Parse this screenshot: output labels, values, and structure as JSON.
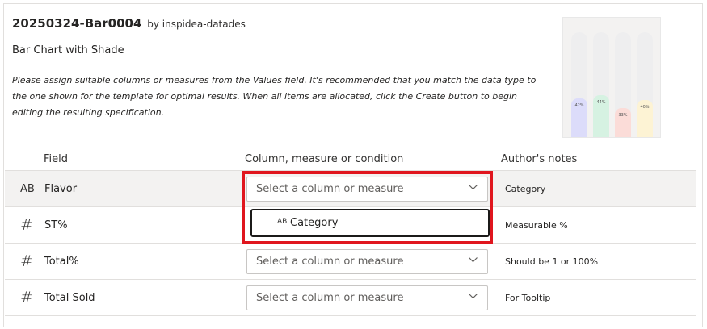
{
  "template": {
    "id": "20250324-Bar0004",
    "author": "by inspidea-datades",
    "name": "Bar Chart with Shade",
    "description": "Please assign suitable columns or measures from the Values field. It's recommended that you match the data type to the one shown for the template for optimal results. When all items are allocated, click the Create button to begin editing the resulting specification."
  },
  "preview": {
    "bars": [
      {
        "label": "42%",
        "value": 0.42,
        "color": "#dcdcfa"
      },
      {
        "label": "44%",
        "value": 0.44,
        "color": "#d6f2e2"
      },
      {
        "label": "33%",
        "value": 0.33,
        "color": "#fbdcd8"
      },
      {
        "label": "40%",
        "value": 0.4,
        "color": "#fdf3d4"
      }
    ]
  },
  "table": {
    "headers": {
      "field": "Field",
      "column": "Column, measure or condition",
      "notes": "Author's notes"
    },
    "rows": [
      {
        "icon": "AB",
        "icon_name": "text-type-icon",
        "field": "Flavor",
        "placeholder": "Select a column or measure",
        "note": "Category"
      },
      {
        "icon": "#",
        "icon_name": "number-type-icon",
        "field": "ST%",
        "placeholder": "",
        "note": "Measurable %"
      },
      {
        "icon": "#",
        "icon_name": "number-type-icon",
        "field": "Total%",
        "placeholder": "Select a column or measure",
        "note": "Should be 1 or 100%"
      },
      {
        "icon": "#",
        "icon_name": "number-type-icon",
        "field": "Total Sold",
        "placeholder": "Select a column or measure",
        "note": "For Tooltip"
      }
    ]
  },
  "dropdown": {
    "icon": "AB",
    "option": "Category"
  },
  "colors": {
    "highlight": "#e0161e",
    "row_hover": "#f3f2f1"
  }
}
